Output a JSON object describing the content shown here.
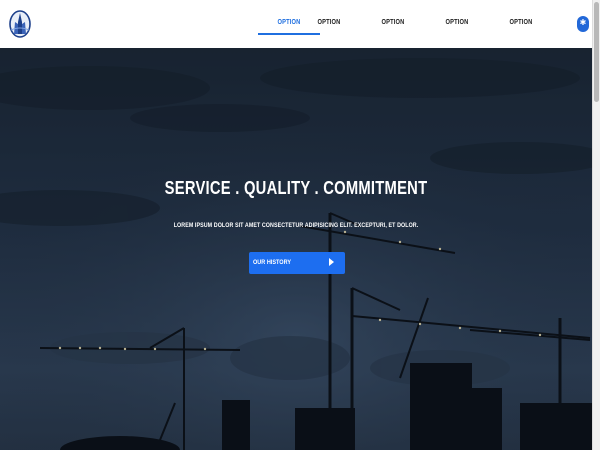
{
  "nav": {
    "items": [
      {
        "label": "OPTION",
        "active": true
      },
      {
        "label": "OPTION",
        "active": false
      },
      {
        "label": "OPTION",
        "active": false
      },
      {
        "label": "OPTION",
        "active": false
      },
      {
        "label": "OPTION",
        "active": false
      }
    ],
    "star_icon": "star-icon"
  },
  "logo": {
    "icon": "building-logo-icon"
  },
  "hero": {
    "title": "SERVICE . QUALITY . COMMITMENT",
    "subtitle": "LOREM IPSUM DOLOR SIT AMET CONSECTETUR ADIPISICING ELIT. EXCEPTURI, ET DOLOR.",
    "cta_label": "OUR HISTORY",
    "cta_icon": "play-arrow-icon",
    "background": "construction-cranes-at-dusk"
  },
  "colors": {
    "accent": "#1f6fe0",
    "cta": "#1d6ef0",
    "nav_text": "#222222"
  }
}
